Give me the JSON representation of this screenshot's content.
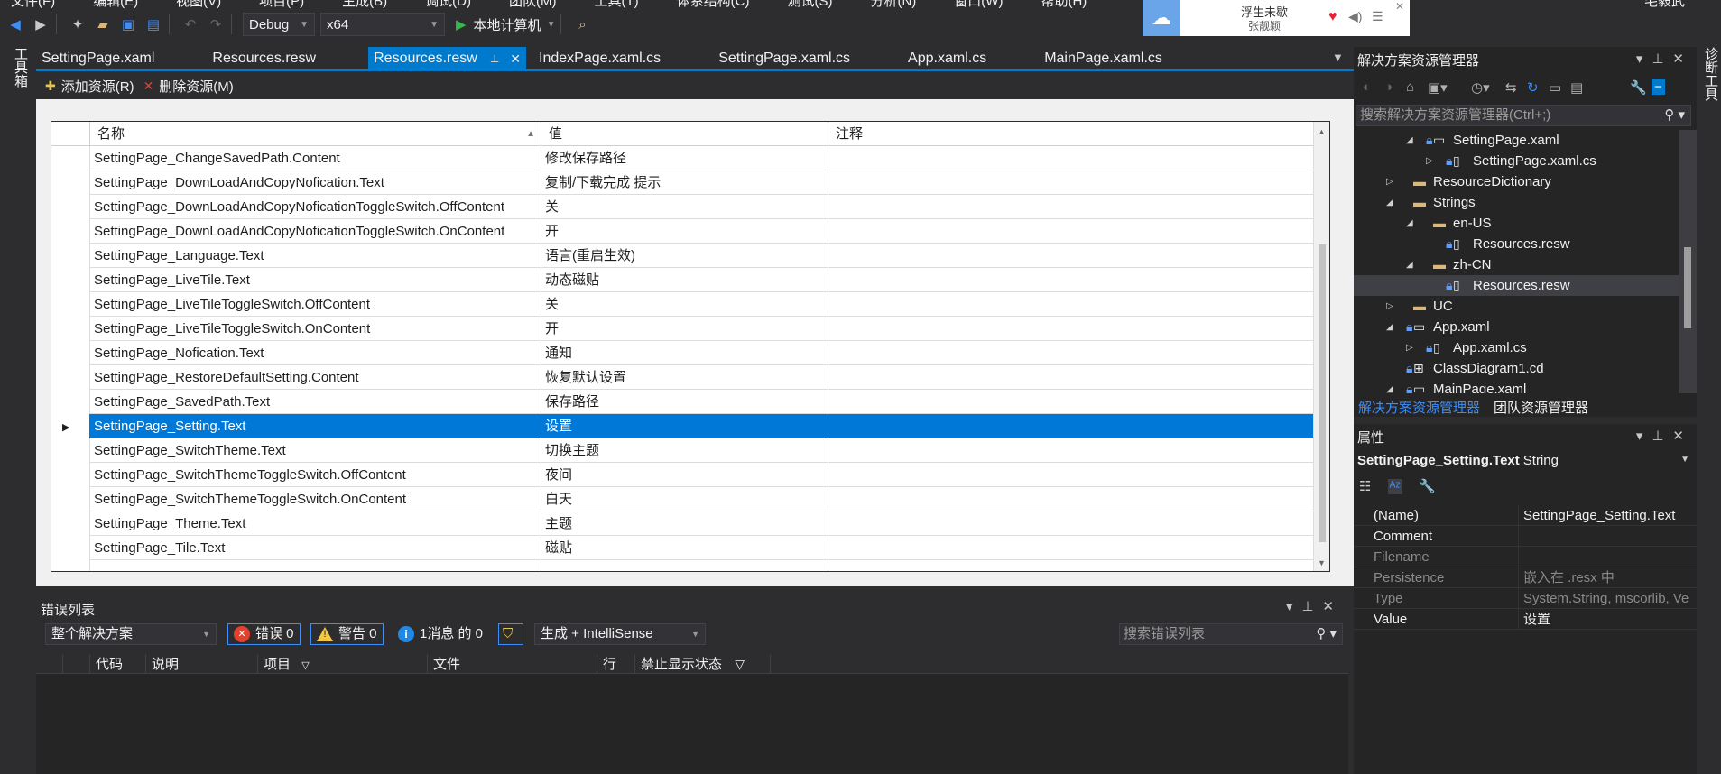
{
  "menubar": {
    "items": [
      "文件(F)",
      "编辑(E)",
      "视图(V)",
      "项目(P)",
      "生成(B)",
      "调试(D)",
      "团队(M)",
      "工具(T)",
      "体系结构(C)",
      "测试(S)",
      "分析(N)",
      "窗口(W)",
      "帮助(H)"
    ],
    "user": "毛毅武"
  },
  "toolbar": {
    "config": "Debug",
    "platform": "x64",
    "run_target": "本地计算机"
  },
  "music": {
    "song": "浮生未歇",
    "artist": "张靓颖"
  },
  "left_strip": {
    "label": "工具箱"
  },
  "right_strip": {
    "label": "诊断工具"
  },
  "tabs": [
    {
      "label": "SettingPage.xaml",
      "active": false
    },
    {
      "label": "Resources.resw",
      "active": false
    },
    {
      "label": "Resources.resw",
      "active": true
    },
    {
      "label": "IndexPage.xaml.cs",
      "active": false
    },
    {
      "label": "SettingPage.xaml.cs",
      "active": false
    },
    {
      "label": "App.xaml.cs",
      "active": false
    },
    {
      "label": "MainPage.xaml.cs",
      "active": false
    }
  ],
  "resw_toolbar": {
    "add": "添加资源(R)",
    "remove": "删除资源(M)"
  },
  "grid": {
    "columns": [
      "名称",
      "值",
      "注释"
    ],
    "rows": [
      {
        "name": "SettingPage_ChangeSavedPath.Content",
        "value": "修改保存路径",
        "comment": ""
      },
      {
        "name": "SettingPage_DownLoadAndCopyNofication.Text",
        "value": "复制/下载完成 提示",
        "comment": ""
      },
      {
        "name": "SettingPage_DownLoadAndCopyNoficationToggleSwitch.OffContent",
        "value": "关",
        "comment": ""
      },
      {
        "name": "SettingPage_DownLoadAndCopyNoficationToggleSwitch.OnContent",
        "value": "开",
        "comment": ""
      },
      {
        "name": "SettingPage_Language.Text",
        "value": "语言(重启生效)",
        "comment": ""
      },
      {
        "name": "SettingPage_LiveTile.Text",
        "value": "动态磁贴",
        "comment": ""
      },
      {
        "name": "SettingPage_LiveTileToggleSwitch.OffContent",
        "value": "关",
        "comment": ""
      },
      {
        "name": "SettingPage_LiveTileToggleSwitch.OnContent",
        "value": "开",
        "comment": ""
      },
      {
        "name": "SettingPage_Nofication.Text",
        "value": "通知",
        "comment": ""
      },
      {
        "name": "SettingPage_RestoreDefaultSetting.Content",
        "value": "恢复默认设置",
        "comment": ""
      },
      {
        "name": "SettingPage_SavedPath.Text",
        "value": "保存路径",
        "comment": ""
      },
      {
        "name": "SettingPage_Setting.Text",
        "value": "设置",
        "comment": "",
        "selected": true
      },
      {
        "name": "SettingPage_SwitchTheme.Text",
        "value": "切换主题",
        "comment": ""
      },
      {
        "name": "SettingPage_SwitchThemeToggleSwitch.OffContent",
        "value": "夜间",
        "comment": ""
      },
      {
        "name": "SettingPage_SwitchThemeToggleSwitch.OnContent",
        "value": "白天",
        "comment": ""
      },
      {
        "name": "SettingPage_Theme.Text",
        "value": "主题",
        "comment": ""
      },
      {
        "name": "SettingPage_Tile.Text",
        "value": "磁贴",
        "comment": ""
      }
    ]
  },
  "errorlist": {
    "title": "错误列表",
    "scope": "整个解决方案",
    "errors": "错误 0",
    "warnings": "警告 0",
    "messages": "1消息 的 0",
    "build": "生成 + IntelliSense",
    "search_placeholder": "搜索错误列表",
    "columns": [
      "代码",
      "说明",
      "项目",
      "文件",
      "行",
      "禁止显示状态"
    ]
  },
  "solution_explorer": {
    "title": "解决方案资源管理器",
    "search_placeholder": "搜索解决方案资源管理器(Ctrl+;)",
    "items": [
      {
        "label": "SettingPage.xaml",
        "level": 2,
        "kind": "xaml",
        "expanded": true
      },
      {
        "label": "SettingPage.xaml.cs",
        "level": 3,
        "kind": "cs",
        "expanded": false
      },
      {
        "label": "ResourceDictionary",
        "level": 1,
        "kind": "folder",
        "expanded": false
      },
      {
        "label": "Strings",
        "level": 1,
        "kind": "folder",
        "expanded": true
      },
      {
        "label": "en-US",
        "level": 2,
        "kind": "folder",
        "expanded": true
      },
      {
        "label": "Resources.resw",
        "level": 3,
        "kind": "file",
        "expanded": null
      },
      {
        "label": "zh-CN",
        "level": 2,
        "kind": "folder",
        "expanded": true
      },
      {
        "label": "Resources.resw",
        "level": 3,
        "kind": "file",
        "expanded": null,
        "selected": true
      },
      {
        "label": "UC",
        "level": 1,
        "kind": "folder",
        "expanded": false
      },
      {
        "label": "App.xaml",
        "level": 1,
        "kind": "xaml",
        "expanded": true
      },
      {
        "label": "App.xaml.cs",
        "level": 2,
        "kind": "cs",
        "expanded": false
      },
      {
        "label": "ClassDiagram1.cd",
        "level": 1,
        "kind": "cd",
        "expanded": null
      },
      {
        "label": "MainPage.xaml",
        "level": 1,
        "kind": "xaml",
        "expanded": true
      }
    ],
    "tabs": [
      "解决方案资源管理器",
      "团队资源管理器"
    ]
  },
  "properties": {
    "title": "属性",
    "object_name": "SettingPage_Setting.Text",
    "object_type": "String",
    "rows": [
      {
        "key": "(Name)",
        "value": "SettingPage_Setting.Text",
        "dim": false
      },
      {
        "key": "Comment",
        "value": "",
        "dim": false
      },
      {
        "key": "Filename",
        "value": "",
        "dim": true
      },
      {
        "key": "Persistence",
        "value": "嵌入在 .resx 中",
        "dim": true
      },
      {
        "key": "Type",
        "value": "System.String, mscorlib, Ve",
        "dim": true
      },
      {
        "key": "Value",
        "value": "设置",
        "dim": false
      }
    ]
  }
}
